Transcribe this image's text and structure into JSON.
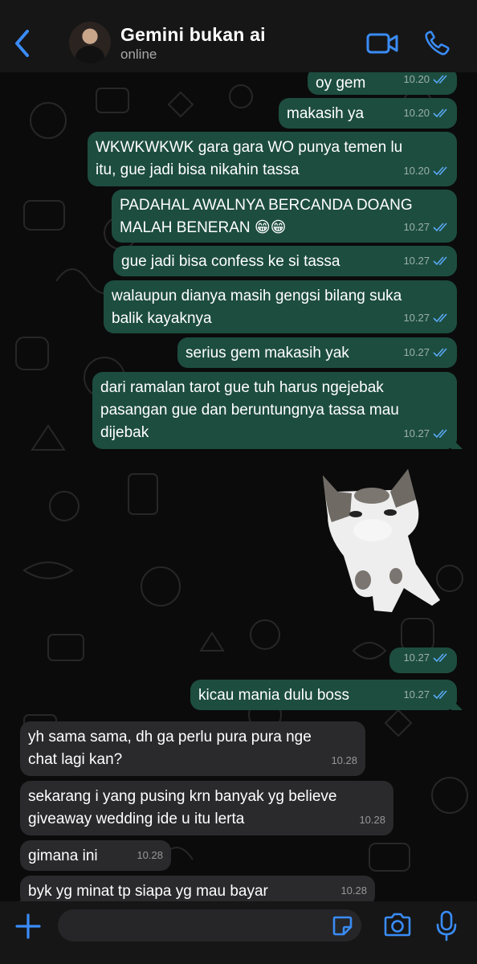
{
  "header": {
    "contact_name": "Gemini bukan ai",
    "status": "online"
  },
  "messages": [
    {
      "text": "oy gem",
      "time": "10.20"
    },
    {
      "text": "makasih ya",
      "time": "10.20"
    },
    {
      "text": "WKWKWKWK gara gara WO punya temen lu\nitu, gue jadi bisa nikahin tassa",
      "time": "10.20"
    },
    {
      "text": "PADAHAL AWALNYA BERCANDA DOANG\nMALAH BENERAN 😁😁",
      "time": "10.27"
    },
    {
      "text": "gue jadi bisa confess ke si tassa",
      "time": "10.27"
    },
    {
      "text": "walaupun dianya masih gengsi bilang suka\nbalik kayaknya",
      "time": "10.27"
    },
    {
      "text": "serius gem makasih yak",
      "time": "10.27"
    },
    {
      "text": "dari ramalan tarot gue tuh harus ngejebak\npasangan gue dan beruntungnya tassa mau\ndijebak",
      "time": "10.27"
    },
    {
      "time": "10.27"
    },
    {
      "text": "kicau mania dulu boss",
      "time": "10.27"
    },
    {
      "text": "yh sama sama, dh ga perlu pura pura nge\nchat lagi kan?",
      "time": "10.28"
    },
    {
      "text": "sekarang i yang pusing krn banyak yg believe\ngiveaway wedding ide u itu lerta",
      "time": "10.28"
    },
    {
      "text": "gimana ini",
      "time": "10.28"
    },
    {
      "text": "byk yg minat tp siapa yg mau bayar",
      "time": "10.28"
    }
  ],
  "composer": {
    "placeholder": ""
  },
  "colors": {
    "outgoing_bubble": "#1d4d3f",
    "incoming_bubble": "#2a2a2c",
    "accent": "#3a8cf7"
  },
  "icons": [
    "back-chevron-icon",
    "video-call-icon",
    "phone-call-icon",
    "double-check-icon",
    "plus-icon",
    "sticker-icon",
    "camera-icon",
    "microphone-icon",
    "cat-sticker"
  ]
}
